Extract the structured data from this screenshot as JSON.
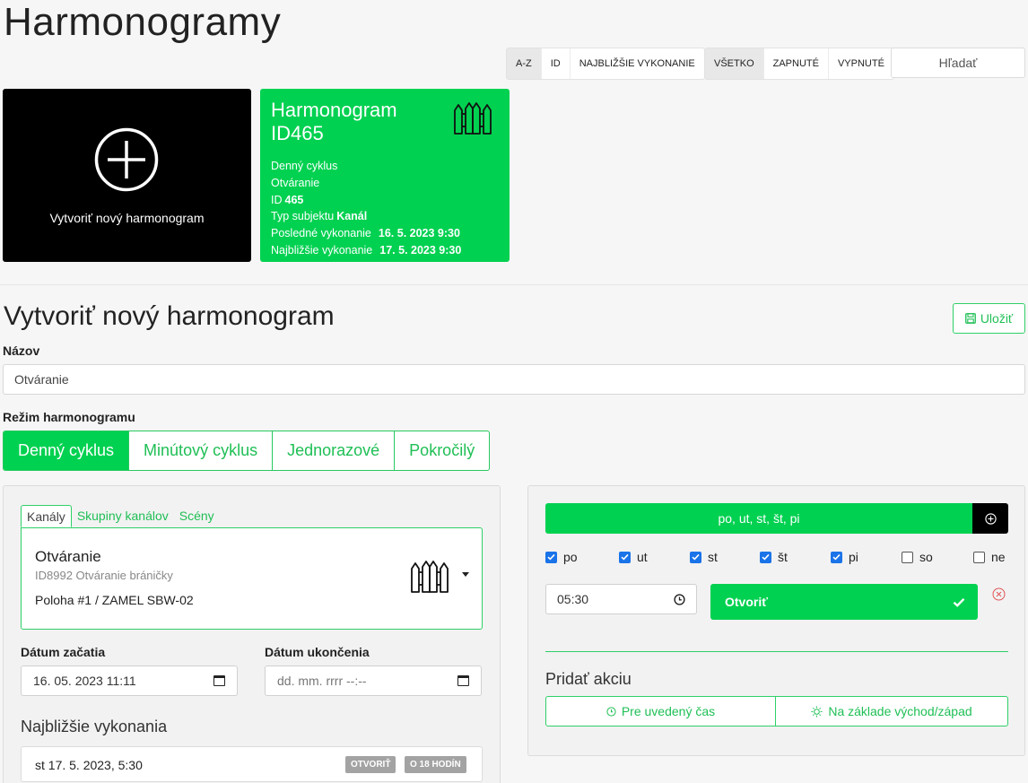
{
  "page": {
    "title": "Harmonogramy"
  },
  "toolbar": {
    "sort": [
      "A-Z",
      "ID",
      "NAJBLIŽŠIE VYKONANIE"
    ],
    "filter": [
      "VŠETKO",
      "ZAPNUTÉ",
      "VYPNUTÉ"
    ],
    "search_placeholder": "Hľadať"
  },
  "create_card": {
    "label": "Vytvoriť nový harmonogram"
  },
  "schedule_card": {
    "title_line1": "Harmonogram",
    "title_line2": "ID465",
    "cycle": "Denný cyklus",
    "action": "Otváranie",
    "id_label": "ID",
    "id_value": "465",
    "subject_label": "Typ subjektu",
    "subject_value": "Kanál",
    "last_label": "Posledné vykonanie",
    "last_value": "16. 5. 2023 9:30",
    "next_label": "Najbližšie vykonanie",
    "next_value": "17. 5. 2023 9:30"
  },
  "form": {
    "title": "Vytvoriť nový harmonogram",
    "save_label": "Uložiť",
    "name_label": "Názov",
    "name_value": "Otváranie",
    "mode_label": "Režim harmonogramu",
    "modes": [
      "Denný cyklus",
      "Minútový cyklus",
      "Jednorazové",
      "Pokročilý"
    ]
  },
  "left_panel": {
    "tabs": [
      "Kanály",
      "Skupiny kanálov",
      "Scény"
    ],
    "channel": {
      "name": "Otváranie",
      "sub": "ID8992 Otváranie bráničky",
      "location": "Poloha #1 / ZAMEL SBW-02"
    },
    "start_label": "Dátum začatia",
    "start_value": "16. 05. 2023 11:11",
    "end_label": "Dátum ukončenia",
    "end_placeholder": "dd. mm. rrrr --:--",
    "next_title": "Najbližšie vykonania",
    "next_item": {
      "text": "st 17. 5. 2023, 5:30",
      "badge_action": "OTVORIŤ",
      "badge_time": "O 18 HODÍN"
    }
  },
  "right_panel": {
    "days_summary": "po, ut, st, št, pi",
    "days": [
      {
        "label": "po",
        "checked": true
      },
      {
        "label": "ut",
        "checked": true
      },
      {
        "label": "st",
        "checked": true
      },
      {
        "label": "št",
        "checked": true
      },
      {
        "label": "pi",
        "checked": true
      },
      {
        "label": "so",
        "checked": false
      },
      {
        "label": "ne",
        "checked": false
      }
    ],
    "time_value": "05:30",
    "action_value": "Otvoriť",
    "add_action_title": "Pridať akciu",
    "add_time_label": "Pre uvedený čas",
    "add_sun_label": "Na základe východ/západ"
  },
  "colors": {
    "accent": "#00d150",
    "accent_text": "#1fbf55",
    "checkbox": "#1a73e8",
    "badge": "#a3a3a3",
    "remove": "#e05555"
  }
}
